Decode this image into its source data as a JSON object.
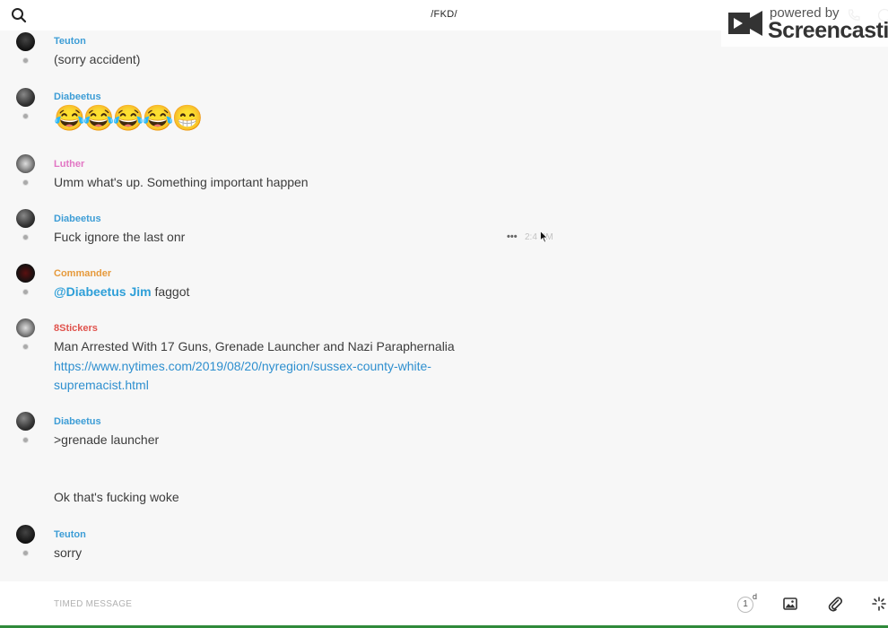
{
  "header": {
    "channel_title": "/FKD/"
  },
  "watermark": {
    "powered_by": "powered by",
    "brand": "Screencastify"
  },
  "messages": [
    {
      "author": "Teuton",
      "author_color": "#3d9dd6",
      "text": "(sorry accident)"
    },
    {
      "author": "Diabeetus",
      "author_color": "#3d9dd6",
      "emojis": "😂😂😂😂😁"
    },
    {
      "author": "Luther",
      "author_color": "#e276c4",
      "text": "Umm what's up. Something important happen"
    },
    {
      "author": "Diabeetus",
      "author_color": "#3d9dd6",
      "text": "Fuck ignore the last onr",
      "hover_more": "•••",
      "hover_time": "2:4  PM"
    },
    {
      "author": "Commander",
      "author_color": "#e69a3c",
      "mention": "@Diabeetus Jim",
      "text": " faggot"
    },
    {
      "author": "8Stickers",
      "author_color": "#e0534d",
      "text": "Man Arrested With 17 Guns, Grenade Launcher and Nazi Paraphernalia",
      "link_line1": "https://www.nytimes.com/2019/08/20/nyregion/sussex-county-white-",
      "link_line2": "supremacist.html"
    },
    {
      "author": "Diabeetus",
      "author_color": "#3d9dd6",
      "text": ">grenade launcher",
      "followup": "Ok that's fucking woke"
    },
    {
      "author": "Teuton",
      "author_color": "#3d9dd6",
      "text": "sorry"
    }
  ],
  "composer": {
    "placeholder": "TIMED MESSAGE",
    "timer_value": "1",
    "timer_unit": "d"
  },
  "colors": {
    "accent": "#2e9fd8",
    "link": "#2e8fcf"
  }
}
